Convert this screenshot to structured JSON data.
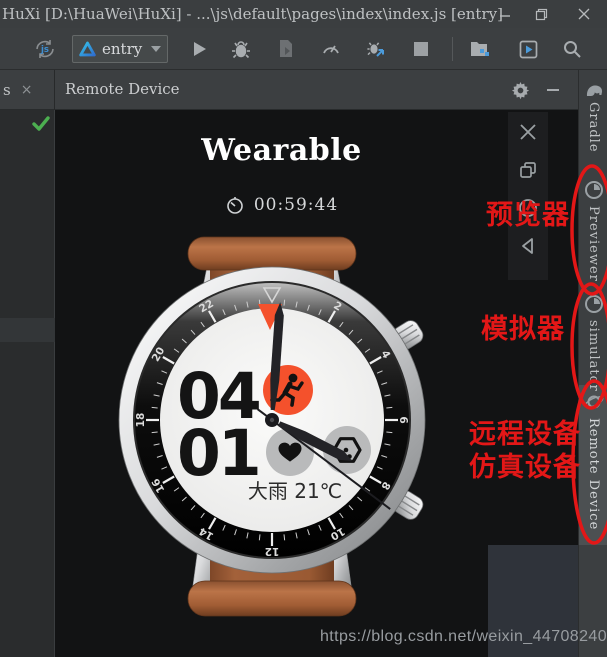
{
  "window": {
    "title": "HuXi [D:\\HuaWei\\HuXi] - ...\\js\\default\\pages\\index\\index.js [entry]"
  },
  "toolbar": {
    "run_config": "entry"
  },
  "tab_strip": {
    "partial_tab": "s",
    "panel_title": "Remote Device"
  },
  "device_view": {
    "title": "Wearable",
    "timer": "00:59:44"
  },
  "watch": {
    "digits_line1": "04",
    "digits_line2": "01",
    "weather": "大雨 21℃",
    "bezel_numbers": [
      2,
      4,
      6,
      8,
      10,
      12,
      14,
      16,
      18,
      20,
      22
    ],
    "hands": {
      "hour_deg": 117,
      "minute_deg": 4,
      "second_deg": 127
    }
  },
  "sidebar": {
    "items": [
      {
        "label": "Gradle",
        "selected": false
      },
      {
        "label": "Previewer",
        "selected": false
      },
      {
        "label": "simulator",
        "selected": false
      },
      {
        "label": "Remote Device",
        "selected": true
      }
    ]
  },
  "annotations": {
    "previewer": "预览器",
    "simulator": "模拟器",
    "remote_device_line1": "远程设备",
    "remote_device_line2": "仿真设备",
    "color": "#e31717"
  },
  "watermark": "https://blog.csdn.net/weixin_44708240",
  "colors": {
    "accent_orange": "#f4512c",
    "ide_gray": "#3c3f41",
    "selection_gray": "#4c5052"
  }
}
